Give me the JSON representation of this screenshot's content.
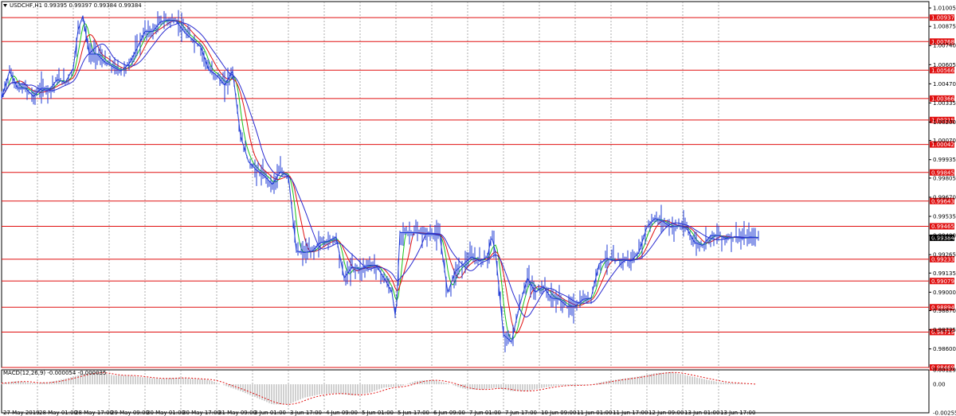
{
  "window": {
    "title": "USDCHF,H1  0.99395 0.99397 0.99384 0.99384",
    "menu_icon": "triangle-down-icon"
  },
  "colors": {
    "price": "#1f3bd6",
    "ma_fast": "#18c418",
    "ma_mid": "#e01010",
    "ma_slow": "#2a2ad0",
    "level": "#e01010",
    "grid": "#000000",
    "macd": "#a0a0a0",
    "signal": "#e01010",
    "current_tag": "#000000"
  },
  "indicator": {
    "title": "MACD(12,26,9) -0.000054 -0.000035"
  },
  "chart_data": [
    {
      "type": "line",
      "name_label": "USDCHF,H1",
      "ylim": [
        0.98469,
        1.0105
      ],
      "y_ticks": [
        "1.01005",
        "1.00875",
        "1.00740",
        "1.00605",
        "1.00470",
        "1.00335",
        "1.00200",
        "1.00070",
        "0.99935",
        "0.99805",
        "0.99670",
        "0.99535",
        "0.99400",
        "0.99265",
        "0.99135",
        "0.99000",
        "0.98870",
        "0.98735",
        "0.98600"
      ],
      "levels": [
        "1.00937",
        "1.00768",
        "1.00566",
        "1.00366",
        "1.00215",
        "1.00042",
        "0.99845",
        "0.99643",
        "0.99465",
        "0.99233",
        "0.99079",
        "0.98894",
        "0.98719",
        "0.98469"
      ],
      "current_price": "0.99384",
      "x_labels": [
        "27 May 2019",
        "28 May 01:00",
        "28 May 17:00",
        "29 May 09:00",
        "30 May 01:00",
        "30 May 17:00",
        "31 May 09:00",
        "3 Jun 01:00",
        "3 Jun 17:00",
        "4 Jun 09:00",
        "5 Jun 01:00",
        "5 Jun 17:00",
        "6 Jun 09:00",
        "7 Jun 01:00",
        "7 Jun 17:00",
        "10 Jun 09:00",
        "11 Jun 01:00",
        "11 Jun 17:00",
        "12 Jun 09:00",
        "13 Jun 01:00",
        "13 Jun 17:00"
      ],
      "series": [
        {
          "x": [
            0,
            10,
            20,
            30,
            40,
            50,
            60,
            70,
            80,
            90,
            96,
            102,
            110,
            120,
            130,
            140,
            150,
            160,
            170,
            180,
            190,
            200,
            210,
            220,
            230,
            240,
            250,
            260,
            270,
            280,
            290,
            300,
            310,
            320,
            330,
            340,
            350,
            360,
            370,
            380,
            390,
            400,
            410,
            420,
            430,
            440,
            450,
            460,
            470,
            480,
            490,
            495,
            500,
            510,
            520,
            530,
            540,
            550,
            560,
            570,
            580,
            590,
            600,
            610,
            615,
            620,
            630,
            640,
            650,
            660,
            670,
            680,
            690,
            700,
            710,
            720,
            730,
            740,
            750,
            760,
            770,
            780,
            790,
            800,
            810,
            820,
            830,
            840,
            850,
            860,
            870,
            880,
            890,
            900,
            910,
            920,
            930,
            940,
            950
          ],
          "values": [
            1.0037,
            1.0056,
            1.0044,
            1.0044,
            1.0038,
            1.0044,
            1.0043,
            1.005,
            1.0048,
            1.0058,
            1.0085,
            1.0095,
            1.0068,
            1.0068,
            1.0062,
            1.0059,
            1.0056,
            1.0061,
            1.0072,
            1.0084,
            1.0084,
            1.0091,
            1.0092,
            1.0091,
            1.0083,
            1.0078,
            1.0073,
            1.0057,
            1.0053,
            1.0046,
            1.0056,
            1.001,
            0.9992,
            0.9986,
            0.9982,
            0.9976,
            0.9985,
            0.9982,
            0.9929,
            0.9928,
            0.9929,
            0.9935,
            0.9936,
            0.9939,
            0.991,
            0.9918,
            0.9916,
            0.9919,
            0.9919,
            0.991,
            0.99,
            0.988,
            0.9942,
            0.9942,
            0.9942,
            0.9941,
            0.9941,
            0.994,
            0.99,
            0.9915,
            0.992,
            0.9925,
            0.9922,
            0.9925,
            0.994,
            0.9928,
            0.987,
            0.9865,
            0.989,
            0.991,
            0.99,
            0.9904,
            0.9896,
            0.9895,
            0.989,
            0.989,
            0.9895,
            0.9896,
            0.992,
            0.9924,
            0.9922,
            0.9923,
            0.9922,
            0.9928,
            0.9946,
            0.9952,
            0.995,
            0.9946,
            0.9947,
            0.9945,
            0.9935,
            0.9933,
            0.994,
            0.994,
            0.9938,
            0.9939,
            0.9938,
            0.9939,
            0.99384
          ]
        }
      ]
    },
    {
      "type": "bar",
      "name_label": "MACD(12,26,9)",
      "ylim": [
        -0.002559,
        0.001297
      ],
      "y_ticks": [
        "0.001297",
        "0.00",
        "-0.002559"
      ],
      "series": [
        {
          "x": [
            0,
            20,
            40,
            60,
            80,
            100,
            120,
            140,
            160,
            180,
            200,
            220,
            240,
            260,
            280,
            300,
            320,
            340,
            360,
            380,
            400,
            420,
            440,
            460,
            480,
            500,
            520,
            540,
            560,
            580,
            600,
            620,
            640,
            660,
            680,
            700,
            720,
            740,
            760,
            780,
            800,
            820,
            840,
            860,
            880,
            900,
            920,
            940
          ],
          "values": [
            0.0001,
            0.0003,
            0.0001,
            0.0002,
            0.0005,
            0.0009,
            0.0011,
            0.0008,
            0.0008,
            0.0006,
            0.0005,
            0.0006,
            0.0005,
            0.0004,
            -0.0001,
            -0.0006,
            -0.0012,
            -0.0018,
            -0.0018,
            -0.0012,
            -0.0009,
            -0.0008,
            -0.001,
            -0.0008,
            -0.0003,
            -0.0002,
            0.0003,
            0.0004,
            0.0001,
            -0.0004,
            -0.0005,
            -0.0003,
            -0.0006,
            -0.0006,
            -0.0003,
            -0.0001,
            -0.0001,
            0.0,
            0.0003,
            0.0005,
            0.0007,
            0.001,
            0.0011,
            0.0008,
            0.0005,
            0.0002,
            0.0001,
            0.0
          ]
        }
      ]
    }
  ]
}
